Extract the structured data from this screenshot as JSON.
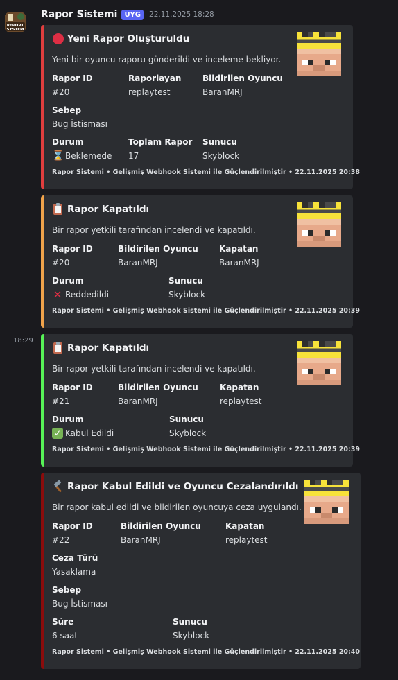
{
  "message": {
    "author": "Rapor Sistemi",
    "tag": "UYG",
    "timestamp": "22.11.2025 18:28",
    "avatar_text": [
      "REPORT",
      "SYSTEM"
    ],
    "side_timestamp": "18:29"
  },
  "embeds": [
    {
      "color": "#e03e3e",
      "icon": "red-circle-icon",
      "title": "Yeni Rapor Oluşturuldu",
      "description": "Yeni bir oyuncu raporu gönderildi ve inceleme bekliyor.",
      "fields": [
        {
          "name": "Rapor ID",
          "value": "#20"
        },
        {
          "name": "Raporlayan",
          "value": "replaytest"
        },
        {
          "name": "Bildirilen Oyuncu",
          "value": "BaranMRJ"
        },
        {
          "name": "Sebep",
          "value": "Bug İstisması"
        },
        {
          "name": "Durum",
          "value": "Beklemede",
          "icon": "hourglass-icon"
        },
        {
          "name": "Toplam Rapor",
          "value": "17"
        },
        {
          "name": "Sunucu",
          "value": "Skyblock"
        }
      ],
      "footer": "Rapor Sistemi • Gelişmiş Webhook Sistemi ile Güçlendirilmiştir • 22.11.2025 20:38"
    },
    {
      "color": "#f0a34b",
      "icon": "clipboard-icon",
      "title": "Rapor Kapatıldı",
      "description": "Bir rapor yetkili tarafından incelendi ve kapatıldı.",
      "fields": [
        {
          "name": "Rapor ID",
          "value": "#20"
        },
        {
          "name": "Bildirilen Oyuncu",
          "value": "BaranMRJ"
        },
        {
          "name": "Kapatan",
          "value": "BaranMRJ"
        },
        {
          "name": "Durum",
          "value": "Reddedildi",
          "icon": "cross-mark-icon"
        },
        {
          "name": "Sunucu",
          "value": "Skyblock"
        }
      ],
      "footer": "Rapor Sistemi • Gelişmiş Webhook Sistemi ile Güçlendirilmiştir • 22.11.2025 20:39"
    },
    {
      "color": "#57f257",
      "icon": "clipboard-icon",
      "title": "Rapor Kapatıldı",
      "description": "Bir rapor yetkili tarafından incelendi ve kapatıldı.",
      "fields": [
        {
          "name": "Rapor ID",
          "value": "#21"
        },
        {
          "name": "Bildirilen Oyuncu",
          "value": "BaranMRJ"
        },
        {
          "name": "Kapatan",
          "value": "replaytest"
        },
        {
          "name": "Durum",
          "value": "Kabul Edildi",
          "icon": "check-mark-icon"
        },
        {
          "name": "Sunucu",
          "value": "Skyblock"
        }
      ],
      "footer": "Rapor Sistemi • Gelişmiş Webhook Sistemi ile Güçlendirilmiştir • 22.11.2025 20:39"
    },
    {
      "color": "#8b0c0c",
      "icon": "hammer-icon",
      "title": "Rapor Kabul Edildi ve Oyuncu Cezalandırıldı",
      "description": "Bir rapor kabul edildi ve bildirilen oyuncuya ceza uygulandı.",
      "fields": [
        {
          "name": "Rapor ID",
          "value": "#22"
        },
        {
          "name": "Bildirilen Oyuncu",
          "value": "BaranMRJ"
        },
        {
          "name": "Kapatan",
          "value": "replaytest"
        },
        {
          "name": "Ceza Türü",
          "value": "Yasaklama"
        },
        {
          "name": "Sebep",
          "value": "Bug İstisması"
        },
        {
          "name": "Süre",
          "value": "6 saat"
        },
        {
          "name": "Sunucu",
          "value": "Skyblock"
        }
      ],
      "footer": "Rapor Sistemi • Gelişmiş Webhook Sistemi ile Güçlendirilmiştir • 22.11.2025 20:40"
    }
  ]
}
